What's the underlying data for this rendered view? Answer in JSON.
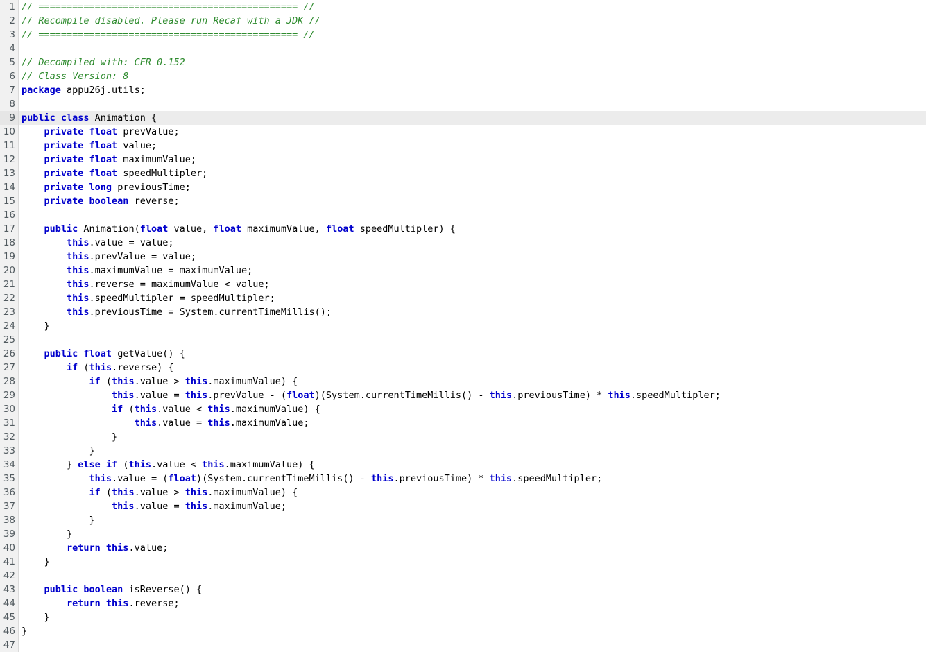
{
  "editor": {
    "language": "java",
    "current_line": 9,
    "first_visible_line": 1,
    "last_visible_line": 47,
    "colors": {
      "background": "#ffffff",
      "gutter_background": "#f1f1f1",
      "gutter_text": "#515a5f",
      "current_line_highlight": "#ececec",
      "comment": "#2e8b2e",
      "keyword": "#0000cc",
      "plain_text": "#000000"
    },
    "lines": [
      {
        "n": 1,
        "tokens": [
          {
            "t": "cmt",
            "s": "// ============================================== //"
          }
        ]
      },
      {
        "n": 2,
        "tokens": [
          {
            "t": "cmt",
            "s": "// Recompile disabled. Please run Recaf with a JDK //"
          }
        ]
      },
      {
        "n": 3,
        "tokens": [
          {
            "t": "cmt",
            "s": "// ============================================== //"
          }
        ]
      },
      {
        "n": 4,
        "tokens": []
      },
      {
        "n": 5,
        "tokens": [
          {
            "t": "cmt",
            "s": "// Decompiled with: CFR 0.152"
          }
        ]
      },
      {
        "n": 6,
        "tokens": [
          {
            "t": "cmt",
            "s": "// Class Version: 8"
          }
        ]
      },
      {
        "n": 7,
        "tokens": [
          {
            "t": "kw",
            "s": "package"
          },
          {
            "t": "pln",
            "s": " appu26j.utils;"
          }
        ]
      },
      {
        "n": 8,
        "tokens": []
      },
      {
        "n": 9,
        "tokens": [
          {
            "t": "kw",
            "s": "public class"
          },
          {
            "t": "pln",
            "s": " Animation {"
          }
        ]
      },
      {
        "n": 10,
        "tokens": [
          {
            "t": "pln",
            "s": "    "
          },
          {
            "t": "kw",
            "s": "private float"
          },
          {
            "t": "pln",
            "s": " prevValue;"
          }
        ]
      },
      {
        "n": 11,
        "tokens": [
          {
            "t": "pln",
            "s": "    "
          },
          {
            "t": "kw",
            "s": "private float"
          },
          {
            "t": "pln",
            "s": " value;"
          }
        ]
      },
      {
        "n": 12,
        "tokens": [
          {
            "t": "pln",
            "s": "    "
          },
          {
            "t": "kw",
            "s": "private float"
          },
          {
            "t": "pln",
            "s": " maximumValue;"
          }
        ]
      },
      {
        "n": 13,
        "tokens": [
          {
            "t": "pln",
            "s": "    "
          },
          {
            "t": "kw",
            "s": "private float"
          },
          {
            "t": "pln",
            "s": " speedMultipler;"
          }
        ]
      },
      {
        "n": 14,
        "tokens": [
          {
            "t": "pln",
            "s": "    "
          },
          {
            "t": "kw",
            "s": "private long"
          },
          {
            "t": "pln",
            "s": " previousTime;"
          }
        ]
      },
      {
        "n": 15,
        "tokens": [
          {
            "t": "pln",
            "s": "    "
          },
          {
            "t": "kw",
            "s": "private boolean"
          },
          {
            "t": "pln",
            "s": " reverse;"
          }
        ]
      },
      {
        "n": 16,
        "tokens": []
      },
      {
        "n": 17,
        "tokens": [
          {
            "t": "pln",
            "s": "    "
          },
          {
            "t": "kw",
            "s": "public"
          },
          {
            "t": "pln",
            "s": " Animation("
          },
          {
            "t": "kw",
            "s": "float"
          },
          {
            "t": "pln",
            "s": " value, "
          },
          {
            "t": "kw",
            "s": "float"
          },
          {
            "t": "pln",
            "s": " maximumValue, "
          },
          {
            "t": "kw",
            "s": "float"
          },
          {
            "t": "pln",
            "s": " speedMultipler) {"
          }
        ]
      },
      {
        "n": 18,
        "tokens": [
          {
            "t": "pln",
            "s": "        "
          },
          {
            "t": "kw",
            "s": "this"
          },
          {
            "t": "pln",
            "s": ".value = value;"
          }
        ]
      },
      {
        "n": 19,
        "tokens": [
          {
            "t": "pln",
            "s": "        "
          },
          {
            "t": "kw",
            "s": "this"
          },
          {
            "t": "pln",
            "s": ".prevValue = value;"
          }
        ]
      },
      {
        "n": 20,
        "tokens": [
          {
            "t": "pln",
            "s": "        "
          },
          {
            "t": "kw",
            "s": "this"
          },
          {
            "t": "pln",
            "s": ".maximumValue = maximumValue;"
          }
        ]
      },
      {
        "n": 21,
        "tokens": [
          {
            "t": "pln",
            "s": "        "
          },
          {
            "t": "kw",
            "s": "this"
          },
          {
            "t": "pln",
            "s": ".reverse = maximumValue < value;"
          }
        ]
      },
      {
        "n": 22,
        "tokens": [
          {
            "t": "pln",
            "s": "        "
          },
          {
            "t": "kw",
            "s": "this"
          },
          {
            "t": "pln",
            "s": ".speedMultipler = speedMultipler;"
          }
        ]
      },
      {
        "n": 23,
        "tokens": [
          {
            "t": "pln",
            "s": "        "
          },
          {
            "t": "kw",
            "s": "this"
          },
          {
            "t": "pln",
            "s": ".previousTime = System.currentTimeMillis();"
          }
        ]
      },
      {
        "n": 24,
        "tokens": [
          {
            "t": "pln",
            "s": "    }"
          }
        ]
      },
      {
        "n": 25,
        "tokens": []
      },
      {
        "n": 26,
        "tokens": [
          {
            "t": "pln",
            "s": "    "
          },
          {
            "t": "kw",
            "s": "public float"
          },
          {
            "t": "pln",
            "s": " getValue() {"
          }
        ]
      },
      {
        "n": 27,
        "tokens": [
          {
            "t": "pln",
            "s": "        "
          },
          {
            "t": "kw",
            "s": "if"
          },
          {
            "t": "pln",
            "s": " ("
          },
          {
            "t": "kw",
            "s": "this"
          },
          {
            "t": "pln",
            "s": ".reverse) {"
          }
        ]
      },
      {
        "n": 28,
        "tokens": [
          {
            "t": "pln",
            "s": "            "
          },
          {
            "t": "kw",
            "s": "if"
          },
          {
            "t": "pln",
            "s": " ("
          },
          {
            "t": "kw",
            "s": "this"
          },
          {
            "t": "pln",
            "s": ".value > "
          },
          {
            "t": "kw",
            "s": "this"
          },
          {
            "t": "pln",
            "s": ".maximumValue) {"
          }
        ]
      },
      {
        "n": 29,
        "tokens": [
          {
            "t": "pln",
            "s": "                "
          },
          {
            "t": "kw",
            "s": "this"
          },
          {
            "t": "pln",
            "s": ".value = "
          },
          {
            "t": "kw",
            "s": "this"
          },
          {
            "t": "pln",
            "s": ".prevValue - ("
          },
          {
            "t": "kw",
            "s": "float"
          },
          {
            "t": "pln",
            "s": ")(System.currentTimeMillis() - "
          },
          {
            "t": "kw",
            "s": "this"
          },
          {
            "t": "pln",
            "s": ".previousTime) * "
          },
          {
            "t": "kw",
            "s": "this"
          },
          {
            "t": "pln",
            "s": ".speedMultipler;"
          }
        ]
      },
      {
        "n": 30,
        "tokens": [
          {
            "t": "pln",
            "s": "                "
          },
          {
            "t": "kw",
            "s": "if"
          },
          {
            "t": "pln",
            "s": " ("
          },
          {
            "t": "kw",
            "s": "this"
          },
          {
            "t": "pln",
            "s": ".value < "
          },
          {
            "t": "kw",
            "s": "this"
          },
          {
            "t": "pln",
            "s": ".maximumValue) {"
          }
        ]
      },
      {
        "n": 31,
        "tokens": [
          {
            "t": "pln",
            "s": "                    "
          },
          {
            "t": "kw",
            "s": "this"
          },
          {
            "t": "pln",
            "s": ".value = "
          },
          {
            "t": "kw",
            "s": "this"
          },
          {
            "t": "pln",
            "s": ".maximumValue;"
          }
        ]
      },
      {
        "n": 32,
        "tokens": [
          {
            "t": "pln",
            "s": "                }"
          }
        ]
      },
      {
        "n": 33,
        "tokens": [
          {
            "t": "pln",
            "s": "            }"
          }
        ]
      },
      {
        "n": 34,
        "tokens": [
          {
            "t": "pln",
            "s": "        } "
          },
          {
            "t": "kw",
            "s": "else if"
          },
          {
            "t": "pln",
            "s": " ("
          },
          {
            "t": "kw",
            "s": "this"
          },
          {
            "t": "pln",
            "s": ".value < "
          },
          {
            "t": "kw",
            "s": "this"
          },
          {
            "t": "pln",
            "s": ".maximumValue) {"
          }
        ]
      },
      {
        "n": 35,
        "tokens": [
          {
            "t": "pln",
            "s": "            "
          },
          {
            "t": "kw",
            "s": "this"
          },
          {
            "t": "pln",
            "s": ".value = ("
          },
          {
            "t": "kw",
            "s": "float"
          },
          {
            "t": "pln",
            "s": ")(System.currentTimeMillis() - "
          },
          {
            "t": "kw",
            "s": "this"
          },
          {
            "t": "pln",
            "s": ".previousTime) * "
          },
          {
            "t": "kw",
            "s": "this"
          },
          {
            "t": "pln",
            "s": ".speedMultipler;"
          }
        ]
      },
      {
        "n": 36,
        "tokens": [
          {
            "t": "pln",
            "s": "            "
          },
          {
            "t": "kw",
            "s": "if"
          },
          {
            "t": "pln",
            "s": " ("
          },
          {
            "t": "kw",
            "s": "this"
          },
          {
            "t": "pln",
            "s": ".value > "
          },
          {
            "t": "kw",
            "s": "this"
          },
          {
            "t": "pln",
            "s": ".maximumValue) {"
          }
        ]
      },
      {
        "n": 37,
        "tokens": [
          {
            "t": "pln",
            "s": "                "
          },
          {
            "t": "kw",
            "s": "this"
          },
          {
            "t": "pln",
            "s": ".value = "
          },
          {
            "t": "kw",
            "s": "this"
          },
          {
            "t": "pln",
            "s": ".maximumValue;"
          }
        ]
      },
      {
        "n": 38,
        "tokens": [
          {
            "t": "pln",
            "s": "            }"
          }
        ]
      },
      {
        "n": 39,
        "tokens": [
          {
            "t": "pln",
            "s": "        }"
          }
        ]
      },
      {
        "n": 40,
        "tokens": [
          {
            "t": "pln",
            "s": "        "
          },
          {
            "t": "kw",
            "s": "return this"
          },
          {
            "t": "pln",
            "s": ".value;"
          }
        ]
      },
      {
        "n": 41,
        "tokens": [
          {
            "t": "pln",
            "s": "    }"
          }
        ]
      },
      {
        "n": 42,
        "tokens": []
      },
      {
        "n": 43,
        "tokens": [
          {
            "t": "pln",
            "s": "    "
          },
          {
            "t": "kw",
            "s": "public boolean"
          },
          {
            "t": "pln",
            "s": " isReverse() {"
          }
        ]
      },
      {
        "n": 44,
        "tokens": [
          {
            "t": "pln",
            "s": "        "
          },
          {
            "t": "kw",
            "s": "return this"
          },
          {
            "t": "pln",
            "s": ".reverse;"
          }
        ]
      },
      {
        "n": 45,
        "tokens": [
          {
            "t": "pln",
            "s": "    }"
          }
        ]
      },
      {
        "n": 46,
        "tokens": [
          {
            "t": "pln",
            "s": "}"
          }
        ]
      },
      {
        "n": 47,
        "tokens": []
      }
    ]
  }
}
